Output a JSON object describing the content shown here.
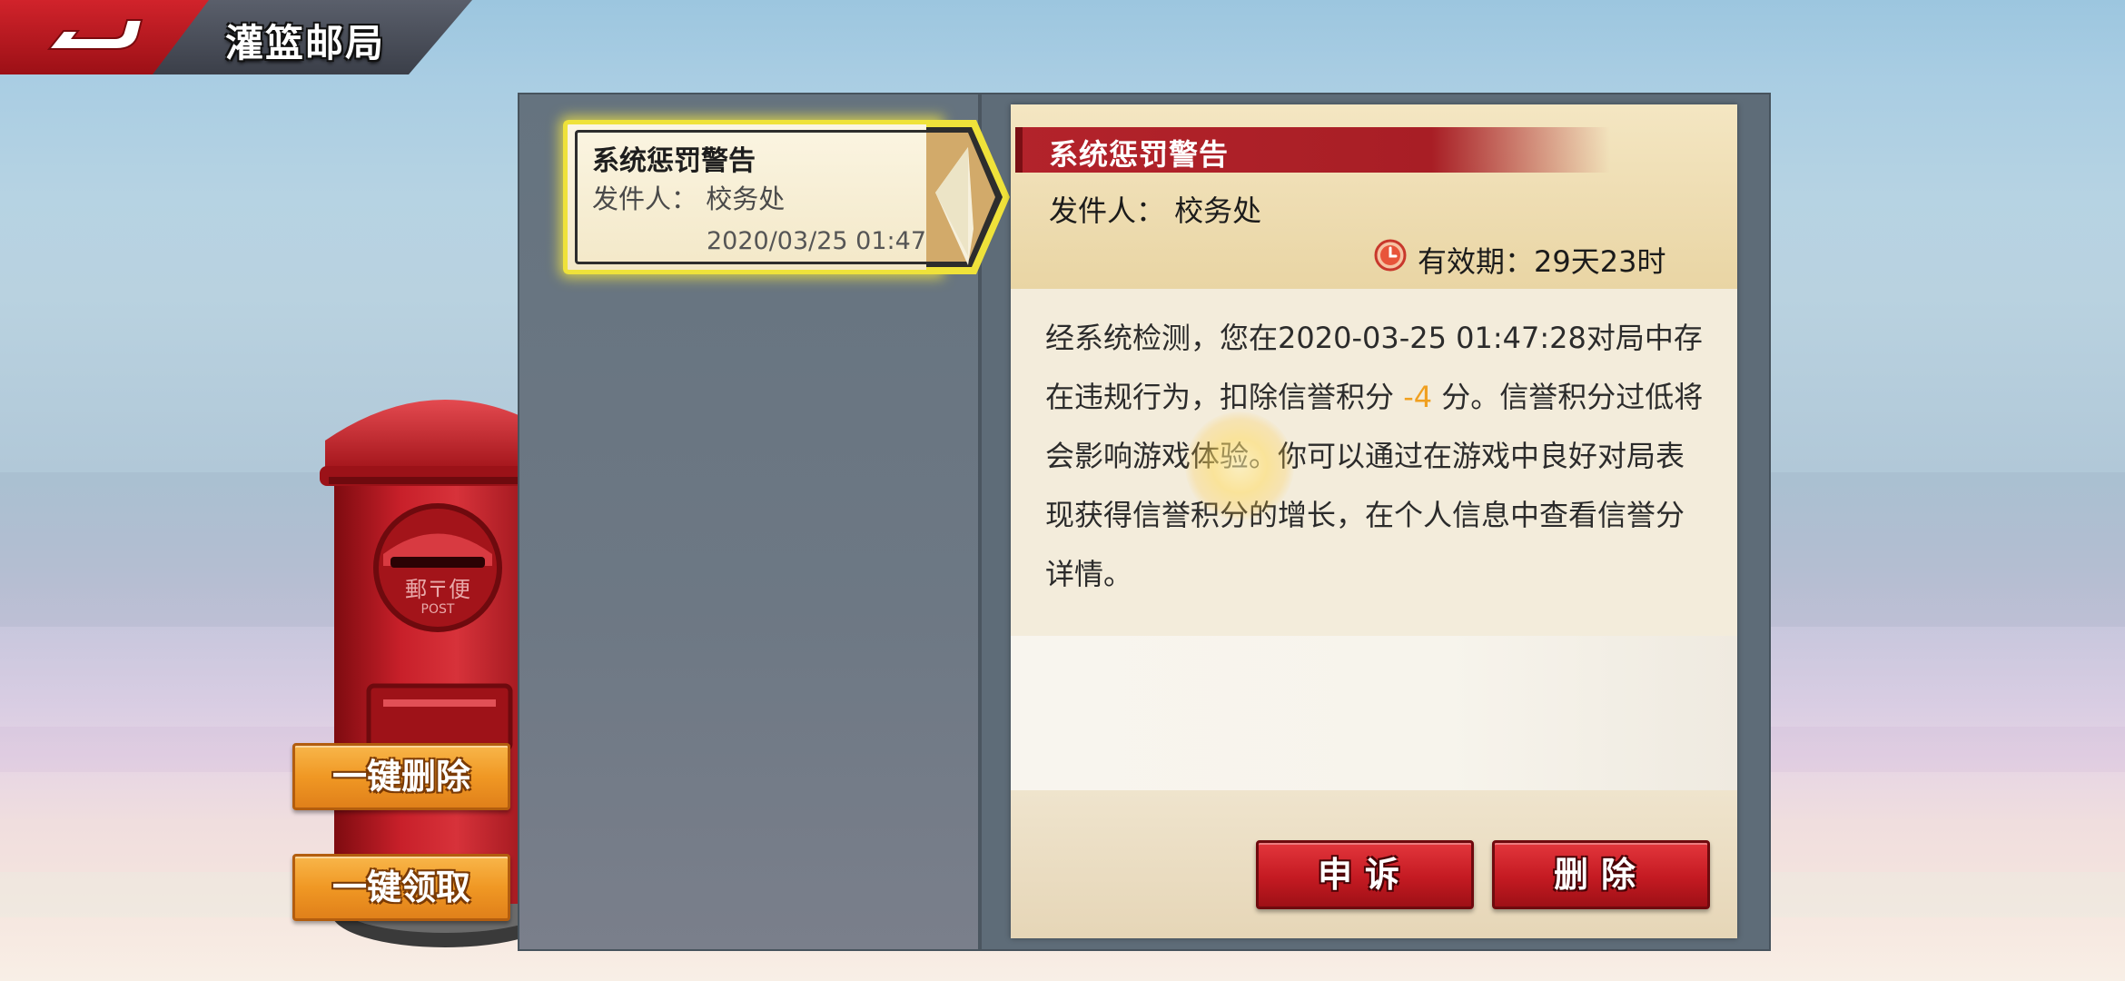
{
  "header": {
    "title": "灌篮邮局"
  },
  "side_buttons": {
    "delete_all": "一键删除",
    "claim_all": "一键领取"
  },
  "mailbox": {
    "label_top": "郵〒便",
    "label_bottom": "POST"
  },
  "mail_list": [
    {
      "title": "系统惩罚警告",
      "sender": "发件人： 校务处",
      "date": "2020/03/25 01:47"
    }
  ],
  "mail_detail": {
    "title": "系统惩罚警告",
    "sender": "发件人： 校务处",
    "validity": "有效期：29天23时",
    "body_before": "经系统检测，您在2020-03-25 01:47:28对局中存在违规行为，扣除信誉积分 ",
    "penalty": "-4",
    "body_after": " 分。信誉积分过低将会影响游戏体验。你可以通过在游戏中良好对局表现获得信誉积分的增长，在个人信息中查看信誉分详情。"
  },
  "actions": {
    "appeal": "申诉",
    "delete": "删除"
  },
  "colors": {
    "accent_red": "#c41a22",
    "accent_orange": "#f09824",
    "penalty": "#f0a020",
    "selected_glow": "#efe23a"
  }
}
